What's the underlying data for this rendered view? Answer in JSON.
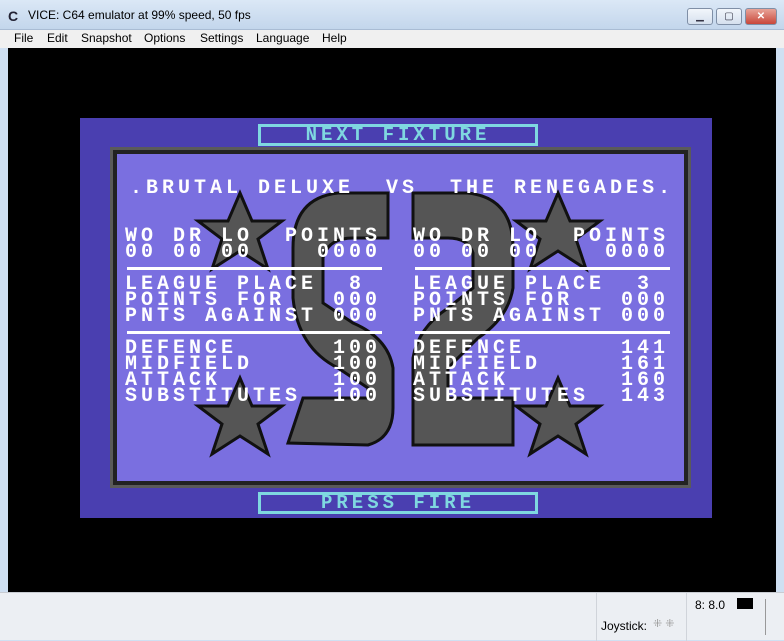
{
  "window": {
    "title": "VICE: C64 emulator at 99% speed, 50 fps",
    "app_icon": "commodore-icon",
    "buttons": [
      "minimize",
      "maximize",
      "close"
    ]
  },
  "menu": [
    "File",
    "Edit",
    "Snapshot",
    "Options",
    "Settings",
    "Language",
    "Help"
  ],
  "game": {
    "header": "NEXT FIXTURE",
    "footer": "PRESS FIRE",
    "fixture": ".BRUTAL DELUXE  VS  THE RENEGADES.",
    "left": {
      "record_header": "WO DR LO  POINTS",
      "record_values": "00 00 00    0000",
      "league_place": "LEAGUE PLACE  8",
      "points_for": "POINTS FOR   000",
      "points_against": "PNTS AGAINST 000",
      "defence": "DEFENCE      100",
      "midfield": "MIDFIELD     100",
      "attack": "ATTACK       100",
      "substitutes": "SUBSTITUTES  100"
    },
    "right": {
      "record_header": "WO DR LO  POINTS",
      "record_values": "00 00 00    0000",
      "league_place": "LEAGUE PLACE  3",
      "points_for": "POINTS FOR   000",
      "points_against": "PNTS AGAINST 000",
      "defence": "DEFENCE      141",
      "midfield": "MIDFIELD     161",
      "attack": "ATTACK       160",
      "substitutes": "SUBSTITUTES  143"
    },
    "colors": {
      "border": "#4a3fb0",
      "panel": "#7a6fe0",
      "accent": "#7fd8e0",
      "logo": "#555555"
    }
  },
  "status": {
    "joystick_label": "Joystick:",
    "drive": "8: 8.0"
  }
}
